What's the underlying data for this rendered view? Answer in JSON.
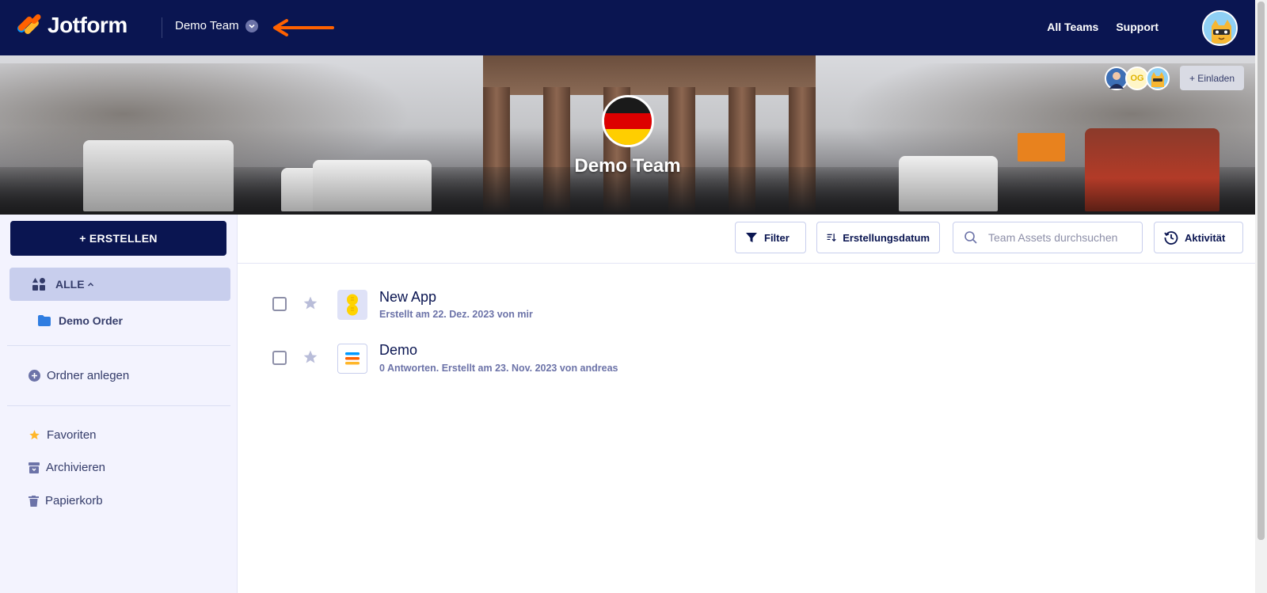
{
  "header": {
    "brand": "Jotform",
    "team_name": "Demo Team",
    "links": [
      "All Teams",
      "Support"
    ]
  },
  "banner": {
    "title": "Demo Team",
    "members": [
      {
        "initials": ""
      },
      {
        "initials": "OG"
      },
      {
        "initials": ""
      }
    ],
    "invite_label": "+ Einladen"
  },
  "sidebar": {
    "create_label": "+ ERSTELLEN",
    "all_label": "ALLE",
    "folder_label": "Demo Order",
    "add_folder_label": "Ordner anlegen",
    "items": [
      {
        "label": "Favoriten",
        "icon": "star-icon"
      },
      {
        "label": "Archivieren",
        "icon": "archive-icon"
      },
      {
        "label": "Papierkorb",
        "icon": "trash-icon"
      }
    ]
  },
  "toolbar": {
    "filter_label": "Filter",
    "sort_label": "Erstellungsdatum",
    "search_placeholder": "Team Assets durchsuchen",
    "activity_label": "Aktivität"
  },
  "assets": [
    {
      "title": "New App",
      "meta": "Erstellt am 22. Dez. 2023 von mir",
      "icon": "app-icon"
    },
    {
      "title": "Demo",
      "meta": "0 Antworten. Erstellt am 23. Nov. 2023 von andreas",
      "icon": "form-icon"
    }
  ],
  "colors": {
    "navy": "#0a1551",
    "sidebar_bg": "#f3f3fe",
    "selected_bg": "#c8ceed",
    "accent_orange": "#ff6100",
    "muted_text": "#6c73a8"
  }
}
